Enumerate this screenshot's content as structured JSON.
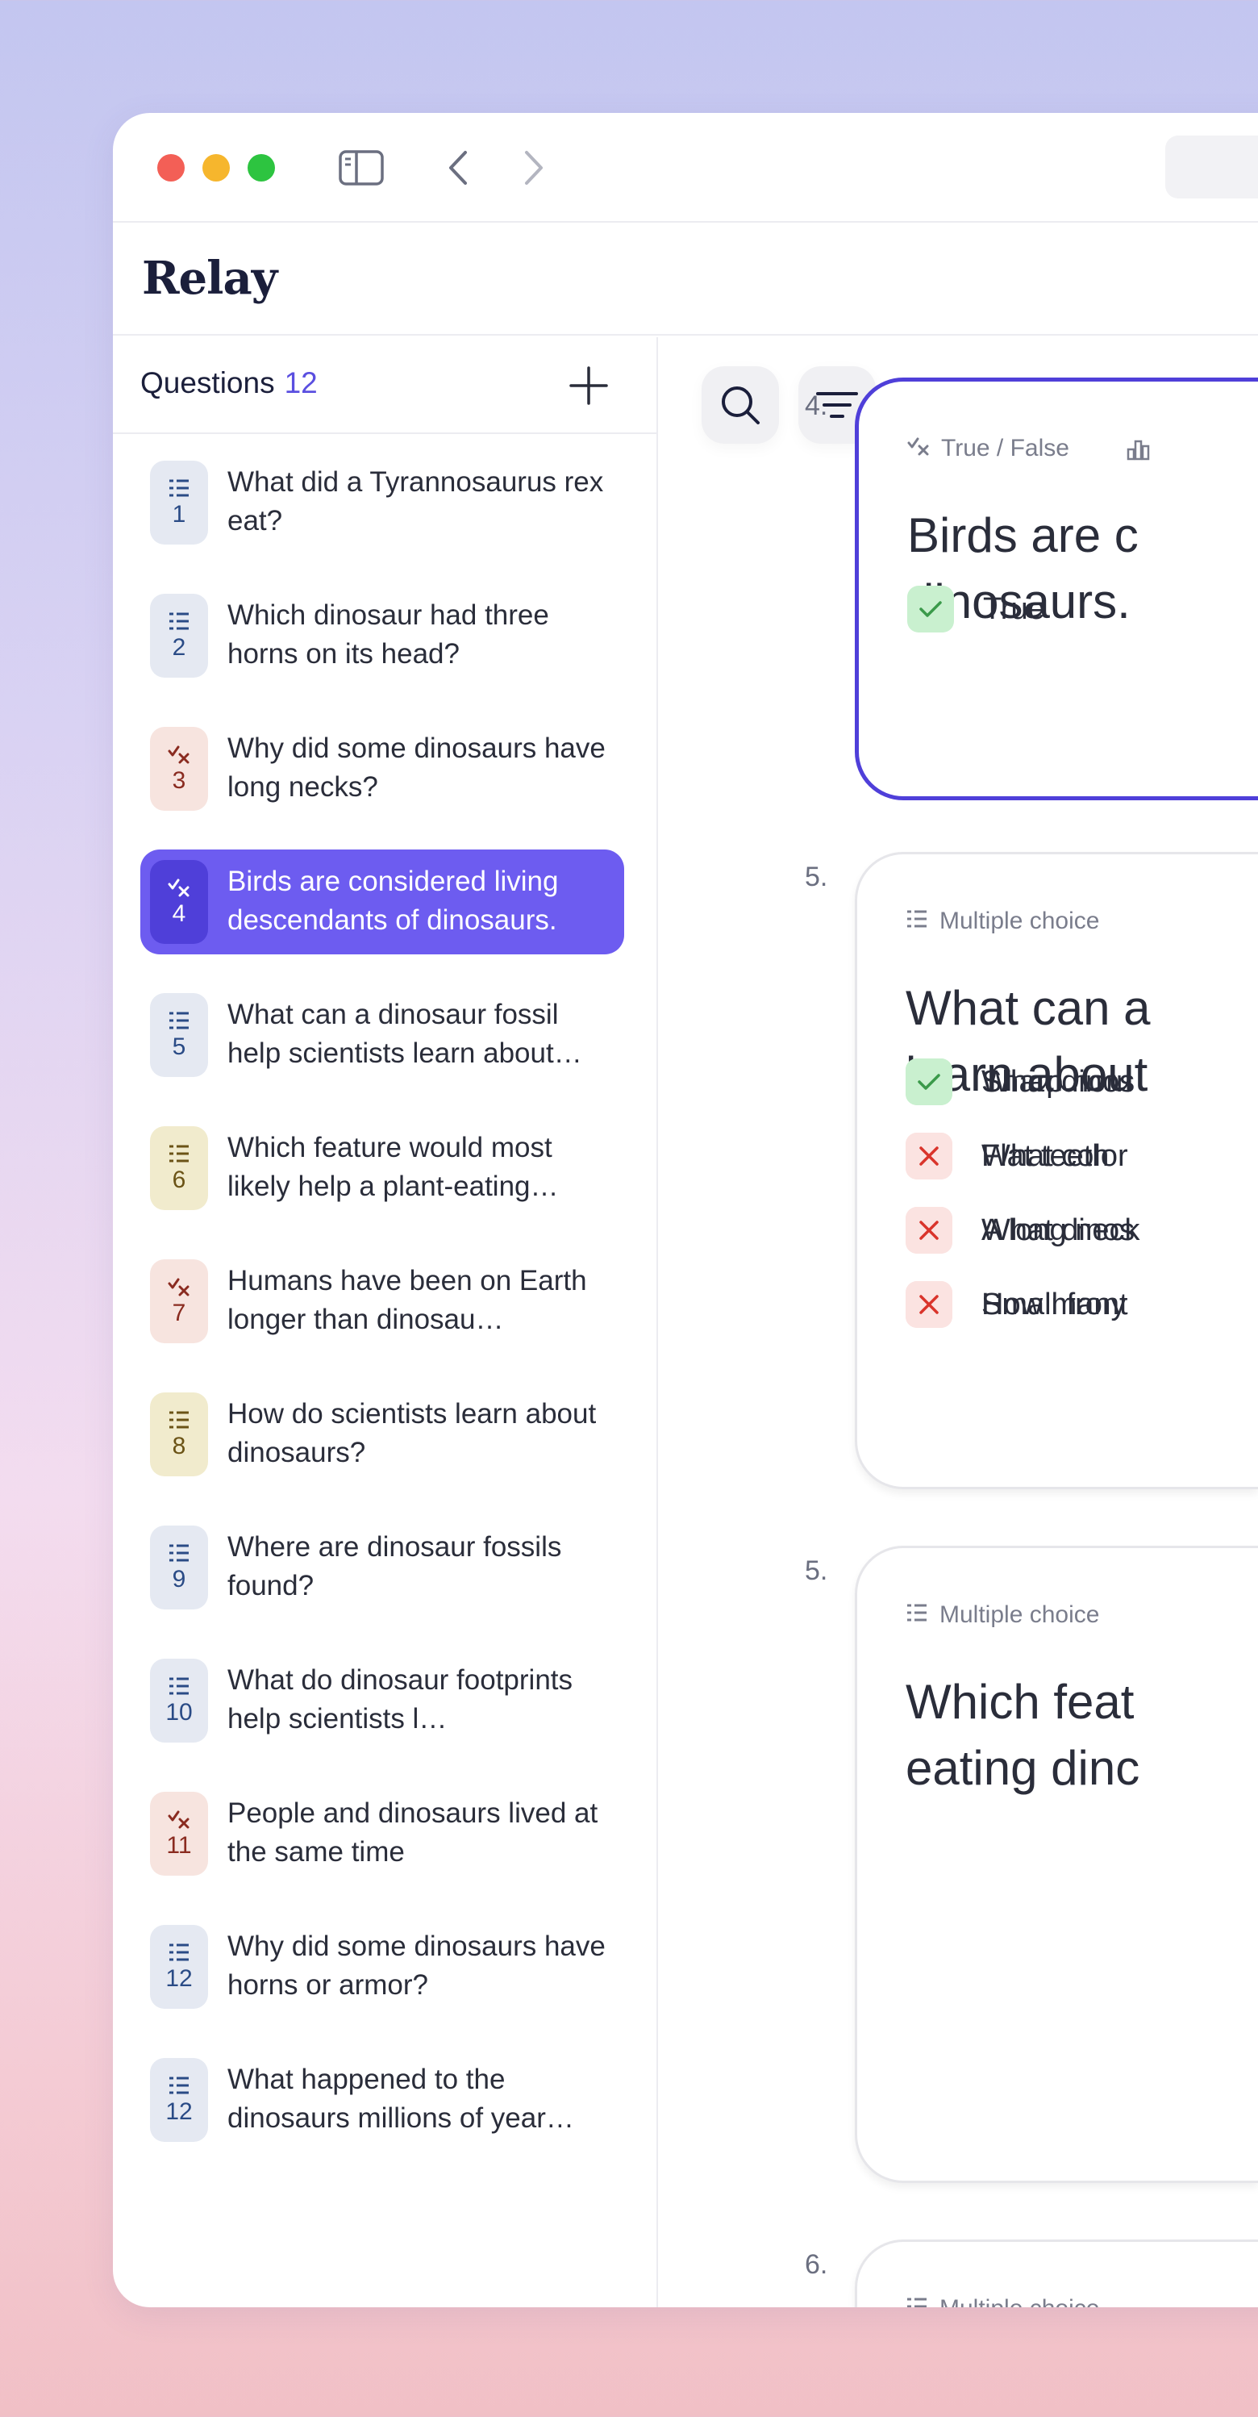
{
  "app": {
    "logo": "Relay"
  },
  "sidebar": {
    "title": "Questions",
    "count": "12",
    "items": [
      {
        "num": "1",
        "text": "What did a Tyrannosaurus rex eat?",
        "kind": "multiple-choice",
        "color": "blue"
      },
      {
        "num": "2",
        "text": "Which dinosaur had three horns on its head?",
        "kind": "multiple-choice",
        "color": "blue"
      },
      {
        "num": "3",
        "text": "Why did some dinosaurs have long necks?",
        "kind": "true-false",
        "color": "red"
      },
      {
        "num": "4",
        "text": "Birds are considered living descendants of dinosaurs.",
        "kind": "true-false",
        "color": "active"
      },
      {
        "num": "5",
        "text": "What can a dinosaur fossil help scientists learn about…",
        "kind": "multiple-choice",
        "color": "blue"
      },
      {
        "num": "6",
        "text": "Which feature would most likely help a plant-eating…",
        "kind": "multiple-choice",
        "color": "yellow"
      },
      {
        "num": "7",
        "text": "Humans have been on Earth longer than dinosau…",
        "kind": "true-false",
        "color": "red"
      },
      {
        "num": "8",
        "text": "How do scientists learn about dinosaurs?",
        "kind": "multiple-choice",
        "color": "yellow"
      },
      {
        "num": "9",
        "text": "Where are dinosaur fossils found?",
        "kind": "multiple-choice",
        "color": "blue"
      },
      {
        "num": "10",
        "text": "What do dinosaur footprints help scientists l…",
        "kind": "multiple-choice",
        "color": "blue"
      },
      {
        "num": "11",
        "text": "People and dinosaurs lived at the same time",
        "kind": "true-false",
        "color": "red"
      },
      {
        "num": "12",
        "text": "Why did some dinosaurs have horns or armor?",
        "kind": "multiple-choice",
        "color": "blue"
      },
      {
        "num": "12",
        "text": "What happened to the dinosaurs millions of year…",
        "kind": "multiple-choice",
        "color": "blue"
      }
    ]
  },
  "cards": [
    {
      "number": "4.",
      "type": "True / False",
      "question_lines": [
        "Birds are c",
        "dinosaurs."
      ],
      "answers": [
        {
          "text": "True",
          "correct": true
        }
      ]
    },
    {
      "number": "5.",
      "type": "Multiple choice",
      "question_lines": [
        "What can a",
        "learn about"
      ],
      "answers": [
        {
          "text": "What dinos",
          "correct": true
        },
        {
          "text": "What color",
          "correct": false
        },
        {
          "text": "What dinos",
          "correct": false
        },
        {
          "text": "How many",
          "correct": false
        }
      ]
    },
    {
      "number": "5.",
      "type": "Multiple choice",
      "question_lines": [
        "Which feat",
        "eating dinc"
      ],
      "answers": [
        {
          "text": "Sharp horn",
          "correct": true
        },
        {
          "text": "Flat teeth",
          "correct": false
        },
        {
          "text": "A long neck",
          "correct": false
        },
        {
          "text": "Small front",
          "correct": false
        }
      ]
    },
    {
      "number": "6.",
      "type": "Multiple choice",
      "question_lines": [],
      "answers": []
    }
  ],
  "colors": {
    "accent": "#5a4fe0",
    "active_item": "#6d5cf0",
    "correct_bg": "#c9f0cf",
    "wrong_bg": "#fbe3e1"
  }
}
